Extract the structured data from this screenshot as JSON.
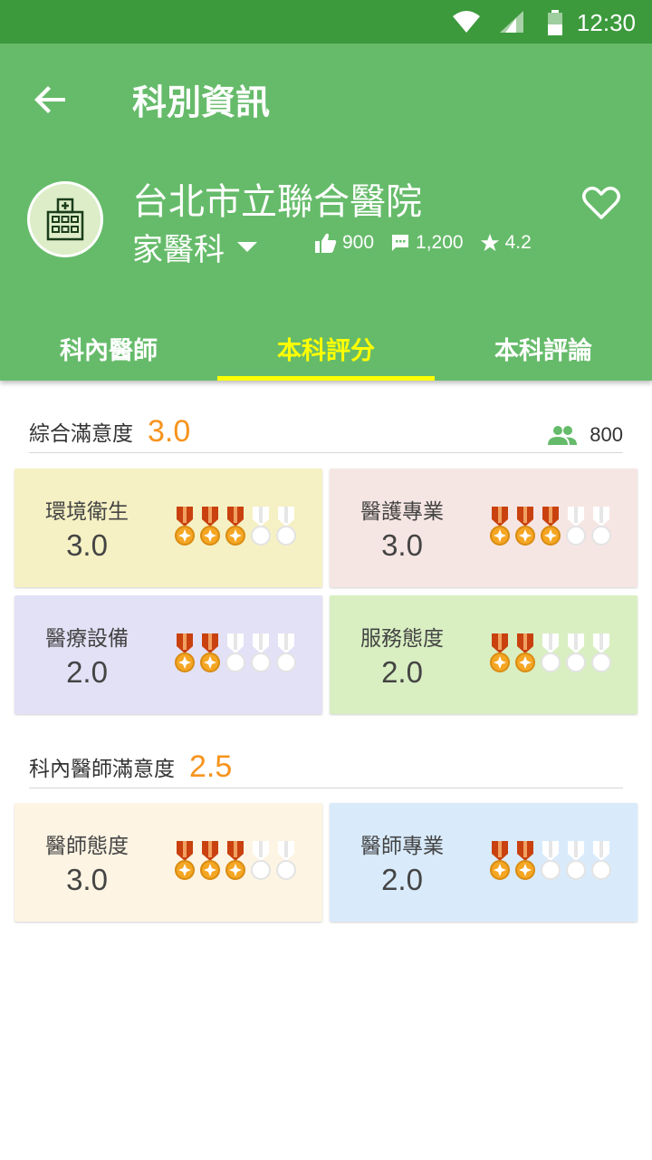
{
  "status": {
    "time": "12:30"
  },
  "header": {
    "title": "科別資訊",
    "hospital": "台北市立聯合醫院",
    "department": "家醫科",
    "likes": "900",
    "comments": "1,200",
    "rating": "4.2"
  },
  "tabs": [
    {
      "label": "科內醫師",
      "active": false
    },
    {
      "label": "本科評分",
      "active": true
    },
    {
      "label": "本科評論",
      "active": false
    }
  ],
  "overall": {
    "title": "綜合滿意度",
    "score": "3.0",
    "count": "800",
    "cards": [
      {
        "label": "環境衛生",
        "score": "3.0",
        "medals": 3,
        "bg": "#f5f1c4"
      },
      {
        "label": "醫護專業",
        "score": "3.0",
        "medals": 3,
        "bg": "#f6e6e3"
      },
      {
        "label": "醫療設備",
        "score": "2.0",
        "medals": 2,
        "bg": "#e3e1f6"
      },
      {
        "label": "服務態度",
        "score": "2.0",
        "medals": 2,
        "bg": "#d9efc2"
      }
    ]
  },
  "doctors": {
    "title": "科內醫師滿意度",
    "score": "2.5",
    "cards": [
      {
        "label": "醫師態度",
        "score": "3.0",
        "medals": 3,
        "bg": "#fdf4e3"
      },
      {
        "label": "醫師專業",
        "score": "2.0",
        "medals": 2,
        "bg": "#d9ebfb"
      }
    ]
  },
  "colors": {
    "status_bar": "#3c9a3c",
    "header": "#66bb6a",
    "active_tab": "#ffff00",
    "score_accent": "#f7941d",
    "people_icon": "#66bb6a"
  },
  "icons": {
    "back": "arrow-left-icon",
    "favorite": "heart-outline-icon",
    "likes": "thumb-up-icon",
    "comments": "comment-icon",
    "rating": "star-icon",
    "count": "people-icon",
    "medal": "medal-icon"
  }
}
